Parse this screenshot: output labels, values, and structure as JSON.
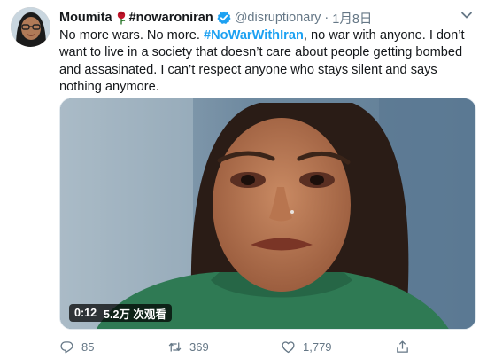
{
  "author": {
    "display_name": "Moumita",
    "hashtag_name": "#nowaroniran",
    "handle": "@disruptionary",
    "separator": "·",
    "time": "1月8日",
    "avatar_icon": "avatar-photo",
    "rose_icon": "rose-icon",
    "verified_icon": "verified-badge-icon"
  },
  "tweet": {
    "text_before": "No more wars. No more. ",
    "hashtag": "#NoWarWithIran",
    "text_after": ", no war with anyone. I don’t want to live in a society that doesn’t care about people getting bombed and assasinated. I can’t respect anyone who stays silent and says nothing anymore."
  },
  "media": {
    "duration": "0:12",
    "views": "5.2万 次观看"
  },
  "actions": {
    "reply_count": "85",
    "retweet_count": "369",
    "like_count": "1,779"
  },
  "colors": {
    "link": "#1da1f2",
    "verified": "#1da1f2",
    "muted": "#657786",
    "text": "#14171a"
  }
}
